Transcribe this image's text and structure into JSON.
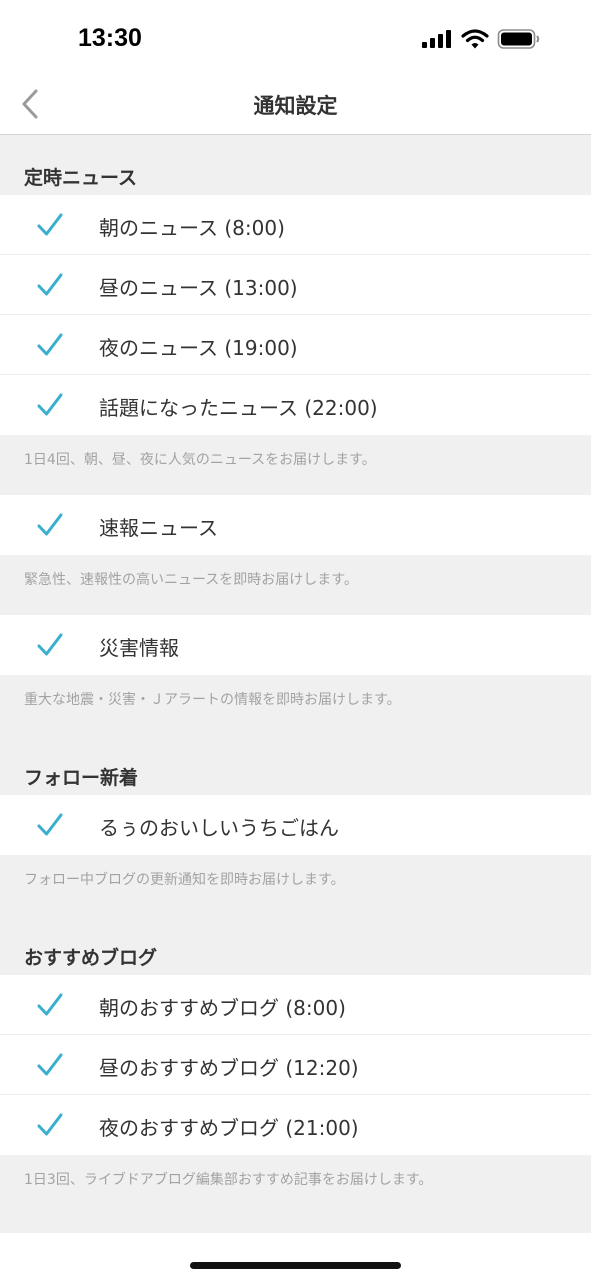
{
  "status_bar": {
    "time": "13:30"
  },
  "nav": {
    "title": "通知設定"
  },
  "sections": {
    "scheduled_news": {
      "header": "定時ニュース",
      "items": [
        {
          "label": "朝のニュース (8:00)",
          "checked": true
        },
        {
          "label": "昼のニュース (13:00)",
          "checked": true
        },
        {
          "label": "夜のニュース (19:00)",
          "checked": true
        },
        {
          "label": "話題になったニュース (22:00)",
          "checked": true
        }
      ],
      "footer": "1日4回、朝、昼、夜に人気のニュースをお届けします。"
    },
    "breaking_news": {
      "items": [
        {
          "label": "速報ニュース",
          "checked": true
        }
      ],
      "footer": "緊急性、速報性の高いニュースを即時お届けします。"
    },
    "disaster": {
      "items": [
        {
          "label": "災害情報",
          "checked": true
        }
      ],
      "footer": "重大な地震・災害・Ｊアラートの情報を即時お届けします。"
    },
    "follow": {
      "header": "フォロー新着",
      "items": [
        {
          "label": "るぅのおいしいうちごはん",
          "checked": true
        }
      ],
      "footer": "フォロー中ブログの更新通知を即時お届けします。"
    },
    "recommended": {
      "header": "おすすめブログ",
      "items": [
        {
          "label": "朝のおすすめブログ (8:00)",
          "checked": true
        },
        {
          "label": "昼のおすすめブログ (12:20)",
          "checked": true
        },
        {
          "label": "夜のおすすめブログ (21:00)",
          "checked": true
        }
      ],
      "footer": "1日3回、ライブドアブログ編集部おすすめ記事をお届けします。"
    }
  },
  "colors": {
    "accent": "#3aaecf",
    "background": "#f0f0f0",
    "footer_text": "#a3a3a3"
  },
  "icons": {
    "back": "chevron-left-icon",
    "check": "checkmark-icon",
    "signal": "cellular-signal-icon",
    "wifi": "wifi-icon",
    "battery": "battery-icon"
  }
}
